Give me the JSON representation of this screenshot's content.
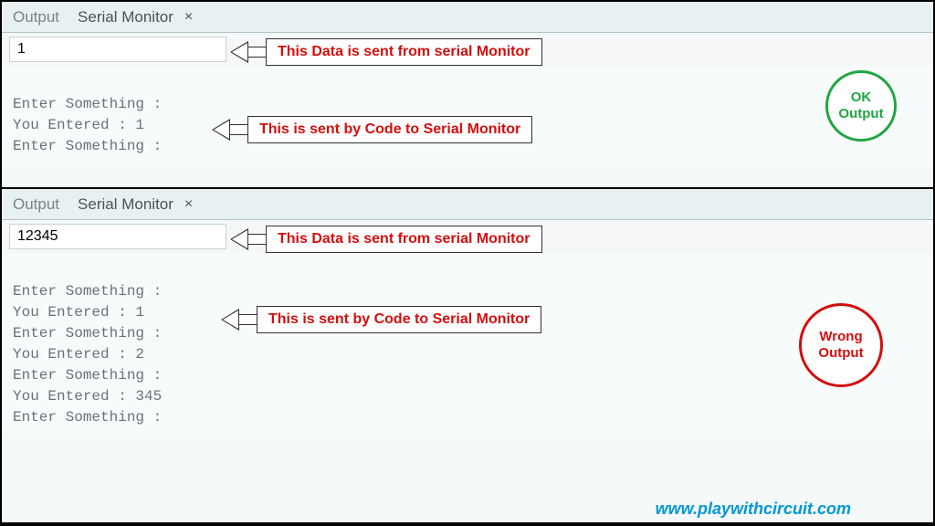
{
  "tabs": {
    "output": "Output",
    "serial": "Serial Monitor",
    "close": "×"
  },
  "panel1": {
    "input_value": "1",
    "output_lines": [
      "",
      "Enter Something :",
      "You Entered : 1",
      "Enter Something :"
    ],
    "callout_input": "This Data is sent from serial Monitor",
    "callout_output": "This is sent by Code to Serial Monitor",
    "badge_line1": "OK",
    "badge_line2": "Output"
  },
  "panel2": {
    "input_value": "12345",
    "output_lines": [
      "",
      "Enter Something :",
      "You Entered : 1",
      "Enter Something :",
      "You Entered : 2",
      "Enter Something :",
      "You Entered : 345",
      "Enter Something :"
    ],
    "callout_input": "This Data is sent from serial Monitor",
    "callout_output": "This is sent by Code to Serial Monitor",
    "badge_line1": "Wrong",
    "badge_line2": "Output"
  },
  "watermark": "www.playwithcircuit.com"
}
